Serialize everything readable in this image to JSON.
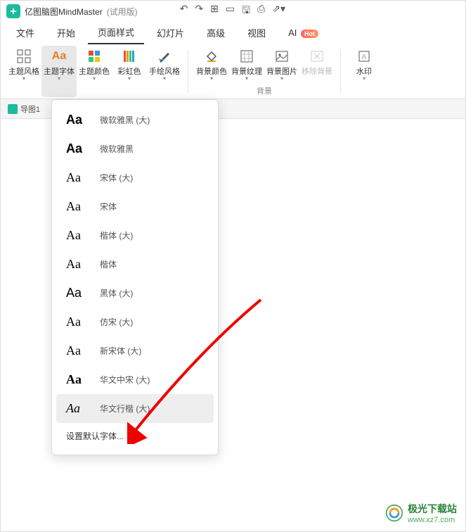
{
  "title": {
    "app": "亿图脑图MindMaster",
    "version": "(试用版)"
  },
  "menu": {
    "items": [
      "文件",
      "开始",
      "页面样式",
      "幻灯片",
      "高级",
      "视图"
    ],
    "ai": "AI",
    "hot": "Hot",
    "active_index": 2
  },
  "ribbon": {
    "buttons": [
      {
        "label": "主题风格",
        "disabled": false
      },
      {
        "label": "主题字体",
        "disabled": false,
        "active": true
      },
      {
        "label": "主题颜色",
        "disabled": false
      },
      {
        "label": "彩虹色",
        "disabled": false
      },
      {
        "label": "手绘风格",
        "disabled": false
      },
      {
        "label": "背景颜色",
        "disabled": false
      },
      {
        "label": "背景纹理",
        "disabled": false
      },
      {
        "label": "背景图片",
        "disabled": false
      },
      {
        "label": "移除背景",
        "disabled": true
      },
      {
        "label": "水印",
        "disabled": false
      }
    ],
    "group_bg": "背景"
  },
  "tab": {
    "name": "导图1"
  },
  "fonts": [
    {
      "sample": "Aa",
      "name": "微软雅黑 (大)",
      "style": "bold"
    },
    {
      "sample": "Aa",
      "name": "微软雅黑",
      "style": "bold"
    },
    {
      "sample": "Aa",
      "name": "宋体 (大)",
      "style": "serif"
    },
    {
      "sample": "Aa",
      "name": "宋体",
      "style": "serif"
    },
    {
      "sample": "Aa",
      "name": "楷体 (大)",
      "style": "serif"
    },
    {
      "sample": "Aa",
      "name": "楷体",
      "style": "serif"
    },
    {
      "sample": "Aa",
      "name": "黑体 (大)",
      "style": ""
    },
    {
      "sample": "Aa",
      "name": "仿宋 (大)",
      "style": "serif"
    },
    {
      "sample": "Aa",
      "name": "新宋体 (大)",
      "style": "serif"
    },
    {
      "sample": "Aa",
      "name": "华文中宋 (大)",
      "style": "serif bold"
    },
    {
      "sample": "Aa",
      "name": "华文行楷 (大)",
      "style": "italic",
      "hover": true
    }
  ],
  "default_font": "设置默认字体...",
  "watermark": {
    "site": "极光下载站",
    "url": "www.xz7.com"
  }
}
